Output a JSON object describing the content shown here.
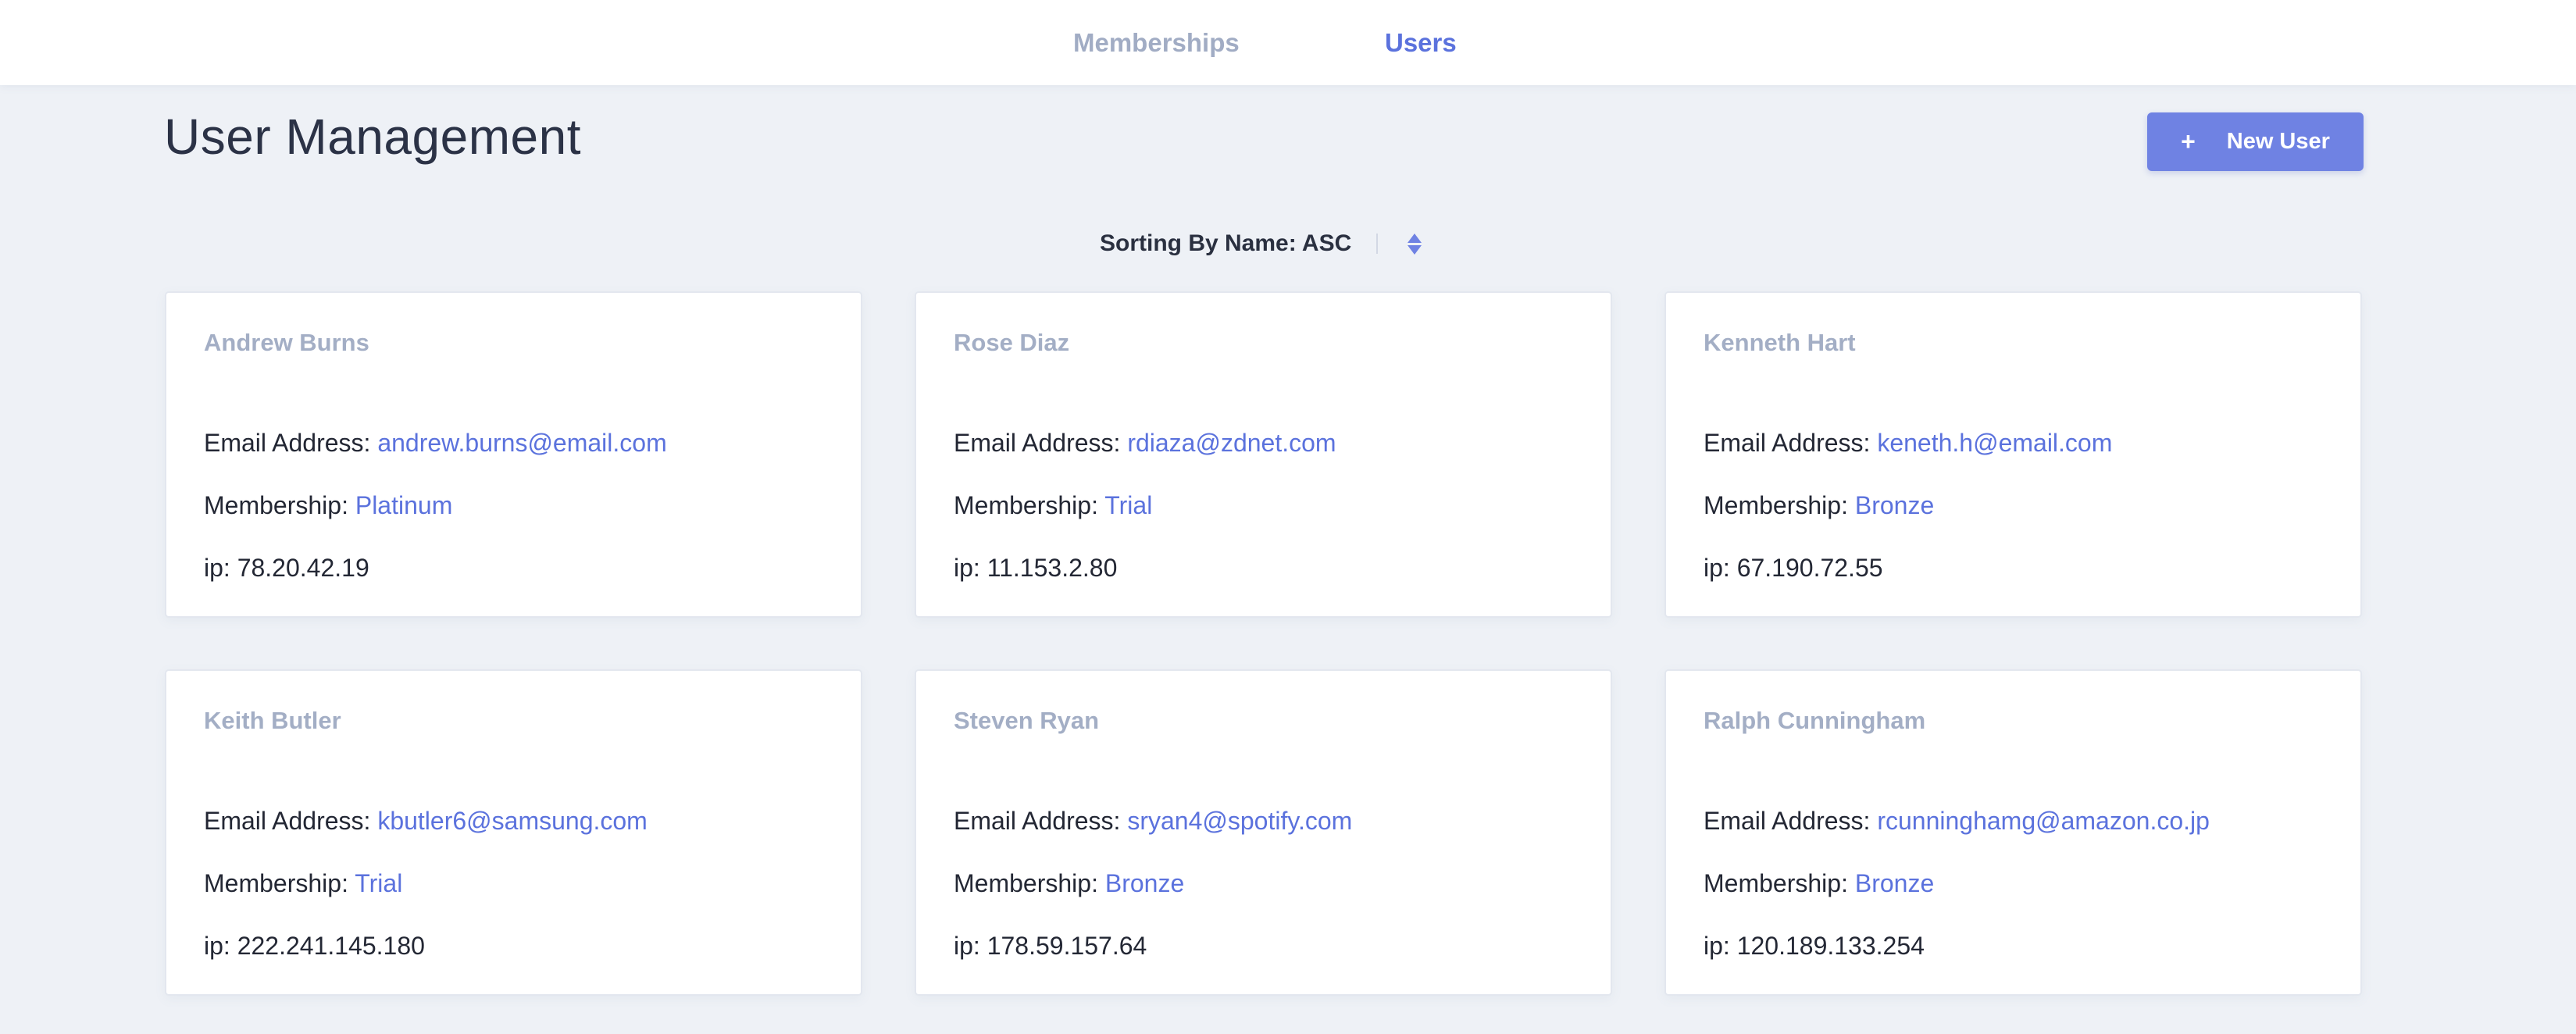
{
  "nav": {
    "memberships": "Memberships",
    "users": "Users"
  },
  "page": {
    "title": "User Management",
    "new_user_button": "New User",
    "new_user_icon": "+"
  },
  "sort": {
    "label": "Sorting By Name: ASC"
  },
  "labels": {
    "email": "Email Address: ",
    "membership": "Membership: ",
    "ip": "ip: "
  },
  "users": [
    {
      "name": "Andrew Burns",
      "email": "andrew.burns@email.com",
      "membership": "Platinum",
      "ip": "78.20.42.19"
    },
    {
      "name": "Rose Diaz",
      "email": "rdiaza@zdnet.com",
      "membership": "Trial",
      "ip": "11.153.2.80"
    },
    {
      "name": "Kenneth Hart",
      "email": "keneth.h@email.com",
      "membership": "Bronze",
      "ip": "67.190.72.55"
    },
    {
      "name": "Keith Butler",
      "email": "kbutler6@samsung.com",
      "membership": "Trial",
      "ip": "222.241.145.180"
    },
    {
      "name": "Steven Ryan",
      "email": "sryan4@spotify.com",
      "membership": "Bronze",
      "ip": "178.59.157.64"
    },
    {
      "name": "Ralph Cunningham",
      "email": "rcunninghamg@amazon.co.jp",
      "membership": "Bronze",
      "ip": "120.189.133.254"
    }
  ],
  "colors": {
    "accent": "#5b72dd",
    "button": "#6f82e3",
    "background": "#eef1f6",
    "muted": "#a3aec5"
  }
}
